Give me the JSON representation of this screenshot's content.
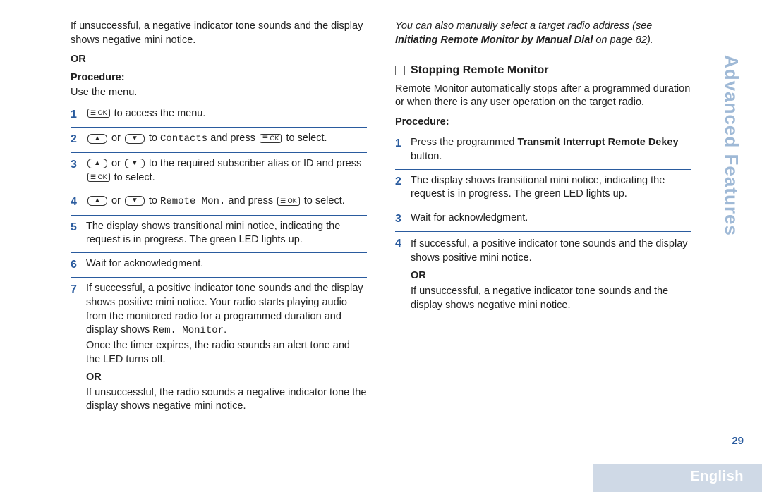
{
  "icons": {
    "ok": "☰ OK",
    "up": "▲",
    "down": "▼"
  },
  "left": {
    "intro": "If unsuccessful, a negative indicator tone sounds and the display shows negative mini notice.",
    "or": "OR",
    "proc_label": "Procedure:",
    "proc_sub": "Use the menu.",
    "s1_a": "to access the menu.",
    "s2_a": "or",
    "s2_b": "to",
    "s2_c": "Contacts",
    "s2_d": "and press",
    "s2_e": "to select.",
    "s3_a": "or",
    "s3_b": "to the required subscriber alias or ID and press",
    "s3_c": "to select.",
    "s4_a": "or",
    "s4_b": "to",
    "s4_c": "Remote Mon.",
    "s4_d": "and press",
    "s4_e": "to select.",
    "s5": "The display shows transitional mini notice, indicating the request is in progress. The green LED lights up.",
    "s6": "Wait for acknowledgment.",
    "s7_a": "If successful, a positive indicator tone sounds and the display shows positive mini notice. Your radio starts playing audio from the monitored radio for a programmed duration and display shows ",
    "s7_b": "Rem. Monitor",
    "s7_c": ".",
    "s7_d": "Once the timer expires, the radio sounds an alert tone and the LED turns off.",
    "s7_or": "OR",
    "s7_e": "If unsuccessful, the radio sounds a negative indicator tone the display shows negative mini notice."
  },
  "right": {
    "note_a": "You can also manually select a target radio address (see ",
    "note_b": "Initiating Remote Monitor by Manual Dial",
    "note_c": " on page 82).",
    "heading": "Stopping Remote Monitor",
    "intro": "Remote Monitor automatically stops after a programmed duration or when there is any user operation on the target radio.",
    "proc_label": "Procedure:",
    "s1_a": "Press the programmed ",
    "s1_b": "Transmit Interrupt Remote Dekey",
    "s1_c": " button.",
    "s2": "The display shows transitional mini notice, indicating the request is in progress. The green LED lights up.",
    "s3": "Wait for acknowledgment.",
    "s4": "If successful, a positive indicator tone sounds and the display shows positive mini notice.",
    "s4_or": "OR",
    "s4_b": "If unsuccessful, a negative indicator tone sounds and the display shows negative mini notice."
  },
  "footer": {
    "section": "Advanced Features",
    "page": "29",
    "lang": "English"
  }
}
